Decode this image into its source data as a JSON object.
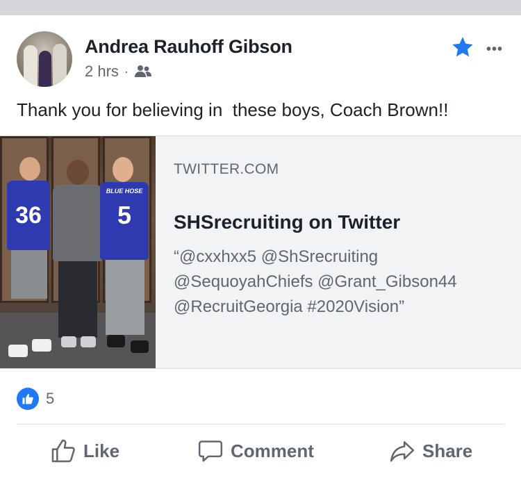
{
  "post": {
    "author": "Andrea Rauhoff Gibson",
    "time": "2 hrs",
    "separator": "·",
    "audience_icon": "friends-icon",
    "text": "Thank you for believing in  these boys, Coach Brown!!",
    "favorite_icon": "star-icon",
    "more_label": "•••"
  },
  "link_card": {
    "domain": "TWITTER.COM",
    "title": "SHSrecruiting on Twitter",
    "description": "“@cxxhxx5 @ShSrecruiting\n@SequoyahChiefs @Grant_Gibson44\n@RecruitGeorgia #2020Vision”",
    "photo": {
      "jersey_left": "36",
      "jersey_right": "5",
      "jersey_right_wordmark": "BLUE HOSE"
    }
  },
  "reactions": {
    "icon": "thumbs-up-icon",
    "count": "5"
  },
  "actions": {
    "like": "Like",
    "comment": "Comment",
    "share": "Share"
  },
  "colors": {
    "accent": "#2078f4",
    "secondary_text": "#606770",
    "primary_text": "#1d2129",
    "card_bg": "#f2f3f5"
  }
}
